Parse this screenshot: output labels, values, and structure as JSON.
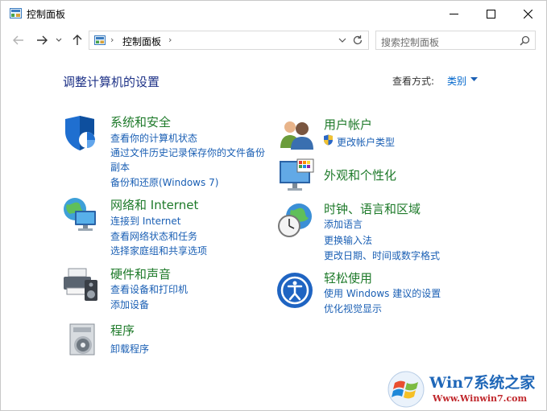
{
  "window": {
    "title": "控制面板",
    "minimize_icon": "minimize-icon",
    "maximize_icon": "maximize-icon",
    "close_icon": "close-icon"
  },
  "nav": {
    "address": "控制面板",
    "search_placeholder": "搜索控制面板"
  },
  "main": {
    "heading": "调整计算机的设置",
    "view_by_label": "查看方式:",
    "view_by_value": "类别"
  },
  "categories": [
    {
      "title": "系统和安全",
      "icon": "shield-icon",
      "links": [
        "查看你的计算机状态",
        "通过文件历史记录保存你的文件备份",
        "副本",
        "备份和还原(Windows 7)"
      ]
    },
    {
      "title": "网络和 Internet",
      "icon": "network-globe-icon",
      "links": [
        "连接到 Internet",
        "查看网络状态和任务",
        "选择家庭组和共享选项"
      ]
    },
    {
      "title": "硬件和声音",
      "icon": "printer-speaker-icon",
      "links": [
        "查看设备和打印机",
        "添加设备"
      ]
    },
    {
      "title": "程序",
      "icon": "programs-disc-icon",
      "links": [
        "卸载程序"
      ]
    },
    {
      "title": "用户帐户",
      "icon": "users-icon",
      "links": [
        "更改帐户类型"
      ]
    },
    {
      "title": "外观和个性化",
      "icon": "monitor-palette-icon",
      "links": []
    },
    {
      "title": "时钟、语言和区域",
      "icon": "clock-globe-icon",
      "links": [
        "添加语言",
        "更换输入法",
        "更改日期、时间或数字格式"
      ]
    },
    {
      "title": "轻松使用",
      "icon": "ease-of-access-icon",
      "links": [
        "使用 Windows 建议的设置",
        "优化视觉显示"
      ]
    }
  ],
  "watermark": {
    "title": "Win7系统之家",
    "url": "Www.Winwin7.com"
  },
  "colors": {
    "category_title": "#1e7a2a",
    "link": "#1a5fb4",
    "heading": "#1e3287"
  }
}
